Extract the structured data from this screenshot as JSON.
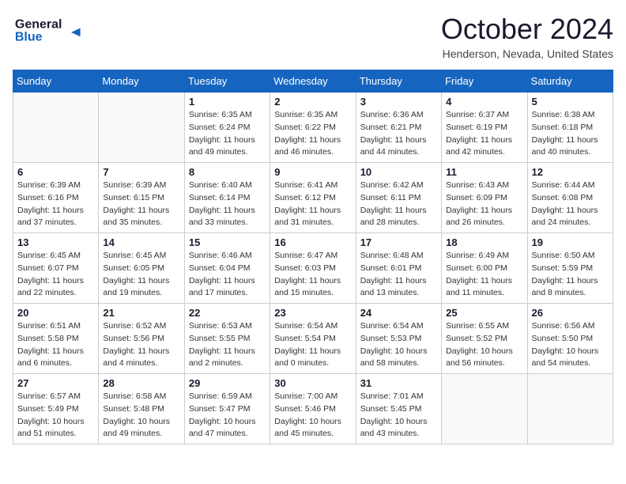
{
  "header": {
    "logo_general": "General",
    "logo_blue": "Blue",
    "month_title": "October 2024",
    "location": "Henderson, Nevada, United States"
  },
  "weekdays": [
    "Sunday",
    "Monday",
    "Tuesday",
    "Wednesday",
    "Thursday",
    "Friday",
    "Saturday"
  ],
  "weeks": [
    [
      {
        "day": "",
        "detail": ""
      },
      {
        "day": "",
        "detail": ""
      },
      {
        "day": "1",
        "detail": "Sunrise: 6:35 AM\nSunset: 6:24 PM\nDaylight: 11 hours and 49 minutes."
      },
      {
        "day": "2",
        "detail": "Sunrise: 6:35 AM\nSunset: 6:22 PM\nDaylight: 11 hours and 46 minutes."
      },
      {
        "day": "3",
        "detail": "Sunrise: 6:36 AM\nSunset: 6:21 PM\nDaylight: 11 hours and 44 minutes."
      },
      {
        "day": "4",
        "detail": "Sunrise: 6:37 AM\nSunset: 6:19 PM\nDaylight: 11 hours and 42 minutes."
      },
      {
        "day": "5",
        "detail": "Sunrise: 6:38 AM\nSunset: 6:18 PM\nDaylight: 11 hours and 40 minutes."
      }
    ],
    [
      {
        "day": "6",
        "detail": "Sunrise: 6:39 AM\nSunset: 6:16 PM\nDaylight: 11 hours and 37 minutes."
      },
      {
        "day": "7",
        "detail": "Sunrise: 6:39 AM\nSunset: 6:15 PM\nDaylight: 11 hours and 35 minutes."
      },
      {
        "day": "8",
        "detail": "Sunrise: 6:40 AM\nSunset: 6:14 PM\nDaylight: 11 hours and 33 minutes."
      },
      {
        "day": "9",
        "detail": "Sunrise: 6:41 AM\nSunset: 6:12 PM\nDaylight: 11 hours and 31 minutes."
      },
      {
        "day": "10",
        "detail": "Sunrise: 6:42 AM\nSunset: 6:11 PM\nDaylight: 11 hours and 28 minutes."
      },
      {
        "day": "11",
        "detail": "Sunrise: 6:43 AM\nSunset: 6:09 PM\nDaylight: 11 hours and 26 minutes."
      },
      {
        "day": "12",
        "detail": "Sunrise: 6:44 AM\nSunset: 6:08 PM\nDaylight: 11 hours and 24 minutes."
      }
    ],
    [
      {
        "day": "13",
        "detail": "Sunrise: 6:45 AM\nSunset: 6:07 PM\nDaylight: 11 hours and 22 minutes."
      },
      {
        "day": "14",
        "detail": "Sunrise: 6:45 AM\nSunset: 6:05 PM\nDaylight: 11 hours and 19 minutes."
      },
      {
        "day": "15",
        "detail": "Sunrise: 6:46 AM\nSunset: 6:04 PM\nDaylight: 11 hours and 17 minutes."
      },
      {
        "day": "16",
        "detail": "Sunrise: 6:47 AM\nSunset: 6:03 PM\nDaylight: 11 hours and 15 minutes."
      },
      {
        "day": "17",
        "detail": "Sunrise: 6:48 AM\nSunset: 6:01 PM\nDaylight: 11 hours and 13 minutes."
      },
      {
        "day": "18",
        "detail": "Sunrise: 6:49 AM\nSunset: 6:00 PM\nDaylight: 11 hours and 11 minutes."
      },
      {
        "day": "19",
        "detail": "Sunrise: 6:50 AM\nSunset: 5:59 PM\nDaylight: 11 hours and 8 minutes."
      }
    ],
    [
      {
        "day": "20",
        "detail": "Sunrise: 6:51 AM\nSunset: 5:58 PM\nDaylight: 11 hours and 6 minutes."
      },
      {
        "day": "21",
        "detail": "Sunrise: 6:52 AM\nSunset: 5:56 PM\nDaylight: 11 hours and 4 minutes."
      },
      {
        "day": "22",
        "detail": "Sunrise: 6:53 AM\nSunset: 5:55 PM\nDaylight: 11 hours and 2 minutes."
      },
      {
        "day": "23",
        "detail": "Sunrise: 6:54 AM\nSunset: 5:54 PM\nDaylight: 11 hours and 0 minutes."
      },
      {
        "day": "24",
        "detail": "Sunrise: 6:54 AM\nSunset: 5:53 PM\nDaylight: 10 hours and 58 minutes."
      },
      {
        "day": "25",
        "detail": "Sunrise: 6:55 AM\nSunset: 5:52 PM\nDaylight: 10 hours and 56 minutes."
      },
      {
        "day": "26",
        "detail": "Sunrise: 6:56 AM\nSunset: 5:50 PM\nDaylight: 10 hours and 54 minutes."
      }
    ],
    [
      {
        "day": "27",
        "detail": "Sunrise: 6:57 AM\nSunset: 5:49 PM\nDaylight: 10 hours and 51 minutes."
      },
      {
        "day": "28",
        "detail": "Sunrise: 6:58 AM\nSunset: 5:48 PM\nDaylight: 10 hours and 49 minutes."
      },
      {
        "day": "29",
        "detail": "Sunrise: 6:59 AM\nSunset: 5:47 PM\nDaylight: 10 hours and 47 minutes."
      },
      {
        "day": "30",
        "detail": "Sunrise: 7:00 AM\nSunset: 5:46 PM\nDaylight: 10 hours and 45 minutes."
      },
      {
        "day": "31",
        "detail": "Sunrise: 7:01 AM\nSunset: 5:45 PM\nDaylight: 10 hours and 43 minutes."
      },
      {
        "day": "",
        "detail": ""
      },
      {
        "day": "",
        "detail": ""
      }
    ]
  ]
}
